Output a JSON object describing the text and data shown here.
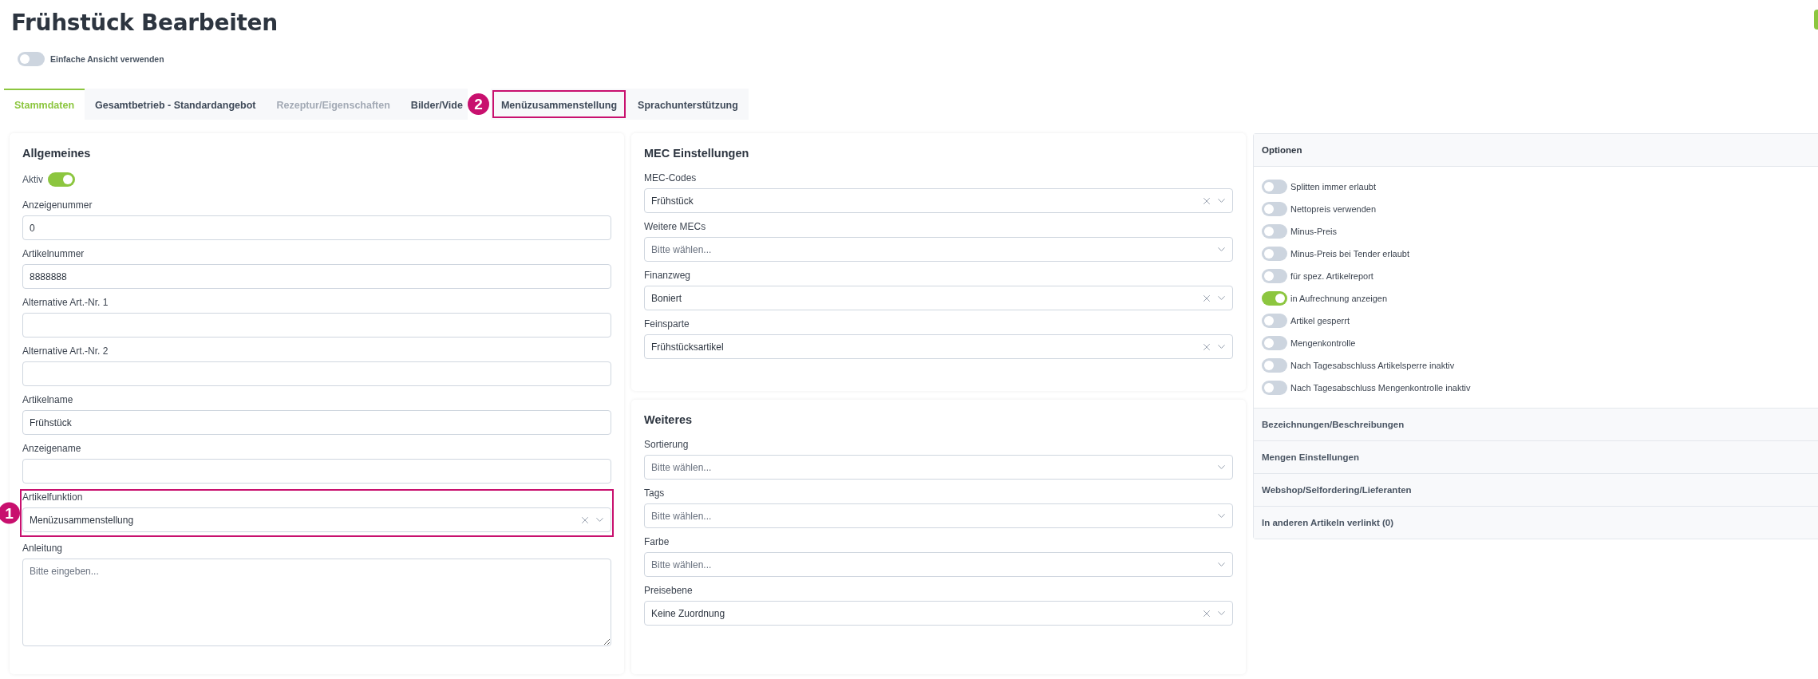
{
  "page": {
    "title": "Frühstück Bearbeiten",
    "simple_view": {
      "label": "Einfache Ansicht verwenden",
      "on": false
    }
  },
  "tabs": [
    {
      "label": "Stammdaten",
      "selected": true,
      "disabled": false,
      "highlighted": false
    },
    {
      "label": "Gesamtbetrieb - Standardangebot",
      "selected": false,
      "disabled": false,
      "highlighted": false
    },
    {
      "label": "Rezeptur/Eigenschaften",
      "selected": false,
      "disabled": true,
      "highlighted": false
    },
    {
      "label": "Bilder/Vide",
      "selected": false,
      "disabled": false,
      "highlighted": false
    },
    {
      "label": "Menüzusammenstellung",
      "selected": false,
      "disabled": false,
      "highlighted": true,
      "callout": "2"
    },
    {
      "label": "Sprachunterstützung",
      "selected": false,
      "disabled": false,
      "highlighted": false
    }
  ],
  "general": {
    "title": "Allgemeines",
    "active": {
      "label": "Aktiv",
      "on": true
    },
    "fields": [
      {
        "kind": "input",
        "label": "Anzeigenummer",
        "value": "0"
      },
      {
        "kind": "input",
        "label": "Artikelnummer",
        "value": "8888888"
      },
      {
        "kind": "input",
        "label": "Alternative Art.-Nr. 1"
      },
      {
        "kind": "input",
        "label": "Alternative Art.-Nr. 2"
      },
      {
        "kind": "input",
        "label": "Artikelname",
        "value": "Frühstück"
      },
      {
        "kind": "input",
        "label": "Anzeigename"
      },
      {
        "kind": "select",
        "label": "Artikelfunktion",
        "value": "Menüzusammenstellung",
        "highlighted": true,
        "callout": "1"
      },
      {
        "kind": "textarea",
        "label": "Anleitung",
        "placeholder": "Bitte eingeben..."
      }
    ]
  },
  "mec": {
    "title": "MEC Einstellungen",
    "fields": [
      {
        "kind": "select",
        "label": "MEC-Codes",
        "value": "Frühstück"
      },
      {
        "kind": "select",
        "label": "Weitere MECs",
        "placeholder": "Bitte wählen..."
      },
      {
        "kind": "select",
        "label": "Finanzweg",
        "value": "Boniert"
      },
      {
        "kind": "select",
        "label": "Feinsparte",
        "value": "Frühstücksartikel"
      }
    ]
  },
  "more": {
    "title": "Weiteres",
    "fields": [
      {
        "kind": "select",
        "label": "Sortierung",
        "placeholder": "Bitte wählen..."
      },
      {
        "kind": "select",
        "label": "Tags",
        "placeholder": "Bitte wählen..."
      },
      {
        "kind": "select",
        "label": "Farbe",
        "placeholder": "Bitte wählen..."
      },
      {
        "kind": "select",
        "label": "Preisebene",
        "value": "Keine Zuordnung"
      }
    ]
  },
  "options": {
    "title": "Optionen",
    "toggles": [
      {
        "label": "Splitten immer erlaubt",
        "on": false
      },
      {
        "label": "Nettopreis verwenden",
        "on": false
      },
      {
        "label": "Minus-Preis",
        "on": false
      },
      {
        "label": "Minus-Preis bei Tender erlaubt",
        "on": false
      },
      {
        "label": "für spez. Artikelreport",
        "on": false
      },
      {
        "label": "in Aufrechnung anzeigen",
        "on": true
      },
      {
        "label": "Artikel gesperrt",
        "on": false
      },
      {
        "label": "Mengenkontrolle",
        "on": false
      },
      {
        "label": "Nach Tagesabschluss Artikelsperre inaktiv",
        "on": false
      },
      {
        "label": "Nach Tagesabschluss Mengenkontrolle inaktiv",
        "on": false
      }
    ],
    "sections": [
      "Bezeichnungen/Beschreibungen",
      "Mengen Einstellungen",
      "Webshop/Selfordering/Lieferanten",
      "In anderen Artikeln verlinkt (0)"
    ]
  }
}
